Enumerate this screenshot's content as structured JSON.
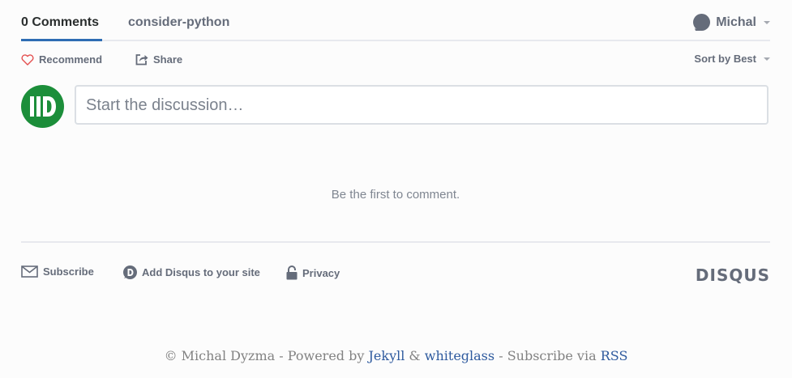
{
  "nav": {
    "tabs": [
      {
        "label": "0 Comments",
        "active": true
      },
      {
        "label": "consider-python",
        "active": false
      }
    ],
    "user": {
      "name": "Michal",
      "icon": "user-avatar-icon"
    }
  },
  "actions": {
    "recommend": {
      "label": "Recommend",
      "icon": "heart-icon"
    },
    "share": {
      "label": "Share",
      "icon": "share-icon"
    },
    "sort": {
      "label": "Sort by Best",
      "icon": "chevron-down-icon"
    }
  },
  "composer": {
    "placeholder": "Start the discussion…",
    "avatar_icon": "user-avatar-icon"
  },
  "empty_state": "Be the first to comment.",
  "footer": {
    "subscribe": "Subscribe",
    "add_disqus": "Add Disqus to your site",
    "privacy": "Privacy",
    "brand": "DISQUS"
  },
  "site_footer": {
    "copyright": "© Michal Dyzma - Powered by ",
    "jekyll": "Jekyll",
    "amp": " & ",
    "whiteglass": "whiteglass",
    "subscribe_via": " - Subscribe via ",
    "rss": "RSS"
  },
  "colors": {
    "accent": "#2e6db4",
    "text": "#2a2e2e",
    "muted": "#656c7a",
    "avatar_green": "#1c8e3a",
    "heart": "#e45050",
    "link": "#2e5a9e"
  }
}
